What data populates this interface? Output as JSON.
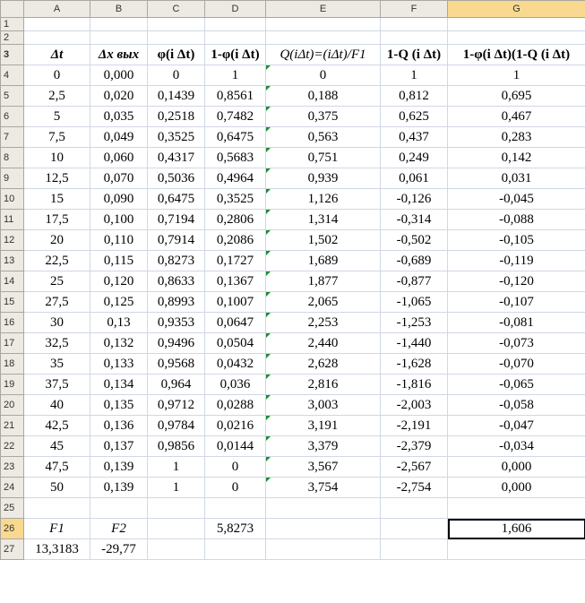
{
  "columns": [
    "A",
    "B",
    "C",
    "D",
    "E",
    "F",
    "G"
  ],
  "selected_column": "G",
  "selected_row": "26",
  "row1": {
    "num": "1"
  },
  "row2": {
    "num": "2"
  },
  "header_row": {
    "num": "3",
    "A": "Δt",
    "B": "Δx вых",
    "C": "φ(i Δt)",
    "D": "1-φ(i Δt)",
    "E": "Q(iΔt)=(iΔt)/F1",
    "F": "1-Q (i Δt)",
    "G": "1-φ(i Δt)(1-Q (i Δt)"
  },
  "rows": [
    {
      "num": "4",
      "A": "0",
      "B": "0,000",
      "C": "0",
      "D": "1",
      "E": "0",
      "F": "1",
      "G": "1"
    },
    {
      "num": "5",
      "A": "2,5",
      "B": "0,020",
      "C": "0,1439",
      "D": "0,8561",
      "E": "0,188",
      "F": "0,812",
      "G": "0,695"
    },
    {
      "num": "6",
      "A": "5",
      "B": "0,035",
      "C": "0,2518",
      "D": "0,7482",
      "E": "0,375",
      "F": "0,625",
      "G": "0,467"
    },
    {
      "num": "7",
      "A": "7,5",
      "B": "0,049",
      "C": "0,3525",
      "D": "0,6475",
      "E": "0,563",
      "F": "0,437",
      "G": "0,283"
    },
    {
      "num": "8",
      "A": "10",
      "B": "0,060",
      "C": "0,4317",
      "D": "0,5683",
      "E": "0,751",
      "F": "0,249",
      "G": "0,142"
    },
    {
      "num": "9",
      "A": "12,5",
      "B": "0,070",
      "C": "0,5036",
      "D": "0,4964",
      "E": "0,939",
      "F": "0,061",
      "G": "0,031"
    },
    {
      "num": "10",
      "A": "15",
      "B": "0,090",
      "C": "0,6475",
      "D": "0,3525",
      "E": "1,126",
      "F": "-0,126",
      "G": "-0,045"
    },
    {
      "num": "11",
      "A": "17,5",
      "B": "0,100",
      "C": "0,7194",
      "D": "0,2806",
      "E": "1,314",
      "F": "-0,314",
      "G": "-0,088"
    },
    {
      "num": "12",
      "A": "20",
      "B": "0,110",
      "C": "0,7914",
      "D": "0,2086",
      "E": "1,502",
      "F": "-0,502",
      "G": "-0,105"
    },
    {
      "num": "13",
      "A": "22,5",
      "B": "0,115",
      "C": "0,8273",
      "D": "0,1727",
      "E": "1,689",
      "F": "-0,689",
      "G": "-0,119"
    },
    {
      "num": "14",
      "A": "25",
      "B": "0,120",
      "C": "0,8633",
      "D": "0,1367",
      "E": "1,877",
      "F": "-0,877",
      "G": "-0,120"
    },
    {
      "num": "15",
      "A": "27,5",
      "B": "0,125",
      "C": "0,8993",
      "D": "0,1007",
      "E": "2,065",
      "F": "-1,065",
      "G": "-0,107"
    },
    {
      "num": "16",
      "A": "30",
      "B": "0,13",
      "C": "0,9353",
      "D": "0,0647",
      "E": "2,253",
      "F": "-1,253",
      "G": "-0,081"
    },
    {
      "num": "17",
      "A": "32,5",
      "B": "0,132",
      "C": "0,9496",
      "D": "0,0504",
      "E": "2,440",
      "F": "-1,440",
      "G": "-0,073"
    },
    {
      "num": "18",
      "A": "35",
      "B": "0,133",
      "C": "0,9568",
      "D": "0,0432",
      "E": "2,628",
      "F": "-1,628",
      "G": "-0,070"
    },
    {
      "num": "19",
      "A": "37,5",
      "B": "0,134",
      "C": "0,964",
      "D": "0,036",
      "E": "2,816",
      "F": "-1,816",
      "G": "-0,065"
    },
    {
      "num": "20",
      "A": "40",
      "B": "0,135",
      "C": "0,9712",
      "D": "0,0288",
      "E": "3,003",
      "F": "-2,003",
      "G": "-0,058"
    },
    {
      "num": "21",
      "A": "42,5",
      "B": "0,136",
      "C": "0,9784",
      "D": "0,0216",
      "E": "3,191",
      "F": "-2,191",
      "G": "-0,047"
    },
    {
      "num": "22",
      "A": "45",
      "B": "0,137",
      "C": "0,9856",
      "D": "0,0144",
      "E": "3,379",
      "F": "-2,379",
      "G": "-0,034"
    },
    {
      "num": "23",
      "A": "47,5",
      "B": "0,139",
      "C": "1",
      "D": "0",
      "E": "3,567",
      "F": "-2,567",
      "G": "0,000"
    },
    {
      "num": "24",
      "A": "50",
      "B": "0,139",
      "C": "1",
      "D": "0",
      "E": "3,754",
      "F": "-2,754",
      "G": "0,000"
    }
  ],
  "row25": {
    "num": "25"
  },
  "row26": {
    "num": "26",
    "A": "F1",
    "B": "F2",
    "D": "5,8273",
    "G": "1,606"
  },
  "row27": {
    "num": "27",
    "A": "13,3183",
    "B": "-29,77"
  },
  "colors": {
    "header_bg": "#eceae3",
    "selected_header_bg": "#f9d990",
    "grid": "#d0d7e5",
    "error_marker": "#1a8f2e"
  }
}
